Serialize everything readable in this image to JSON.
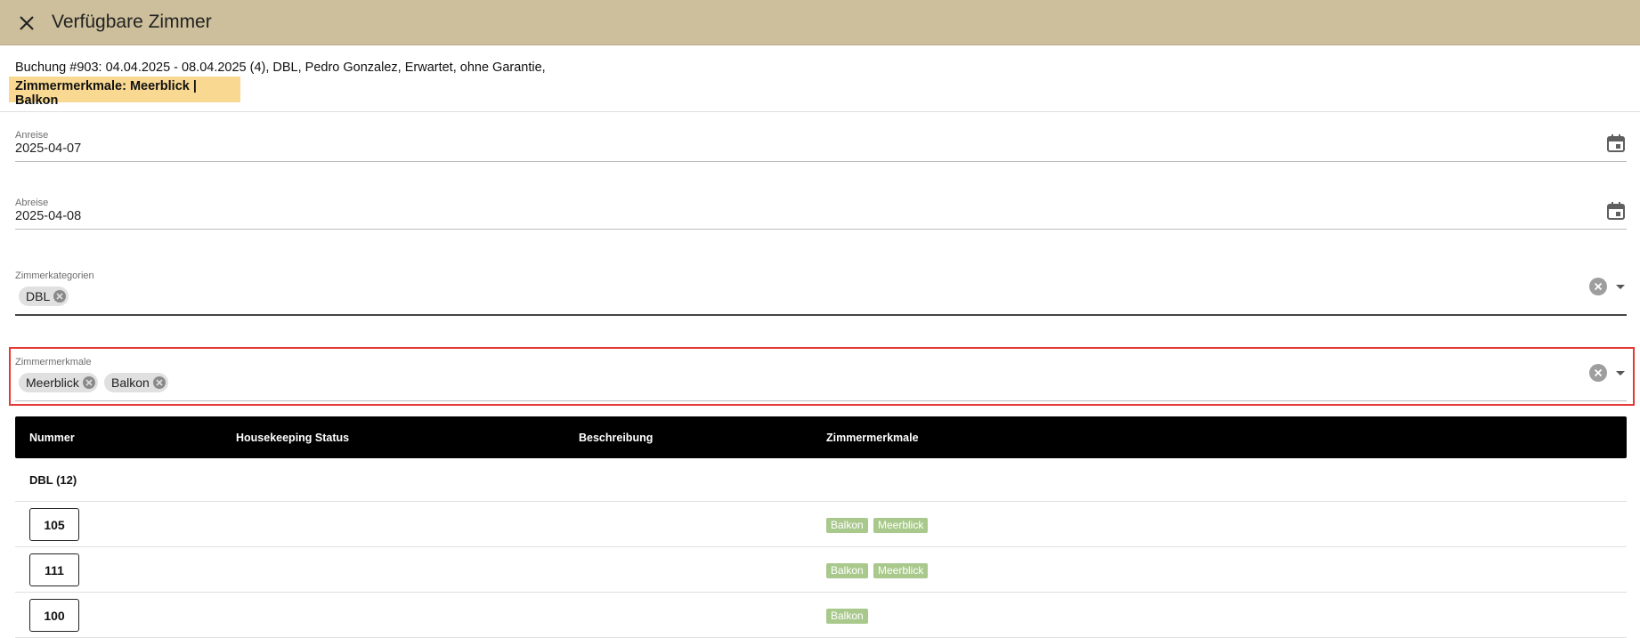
{
  "header": {
    "title": "Verfügbare Zimmer",
    "close_icon": "close-icon"
  },
  "summary": {
    "booking_text": "Buchung #903: 04.04.2025 - 08.04.2025 (4), DBL, Pedro Gonzalez, Erwartet, ohne Garantie,",
    "features_text": "Zimmermerkmale: Meerblick | Balkon"
  },
  "fields": {
    "arrival": {
      "label": "Anreise",
      "value": "2025-04-07"
    },
    "departure": {
      "label": "Abreise",
      "value": "2025-04-08"
    },
    "categories": {
      "label": "Zimmerkategorien",
      "chips": [
        "DBL"
      ]
    },
    "features": {
      "label": "Zimmermerkmale",
      "chips": [
        "Meerblick",
        "Balkon"
      ]
    }
  },
  "table": {
    "columns": [
      "Nummer",
      "Housekeeping Status",
      "Beschreibung",
      "Zimmermerkmale"
    ],
    "group": "DBL (12)",
    "rows": [
      {
        "number": "105",
        "features": [
          "Balkon",
          "Meerblick"
        ]
      },
      {
        "number": "111",
        "features": [
          "Balkon",
          "Meerblick"
        ]
      },
      {
        "number": "100",
        "features": [
          "Balkon"
        ]
      }
    ]
  },
  "colors": {
    "header_bg": "#cdbf9b",
    "highlight_bg": "#f9d892",
    "focus_outline": "#e53935",
    "tag_bg": "#a9c98c"
  }
}
